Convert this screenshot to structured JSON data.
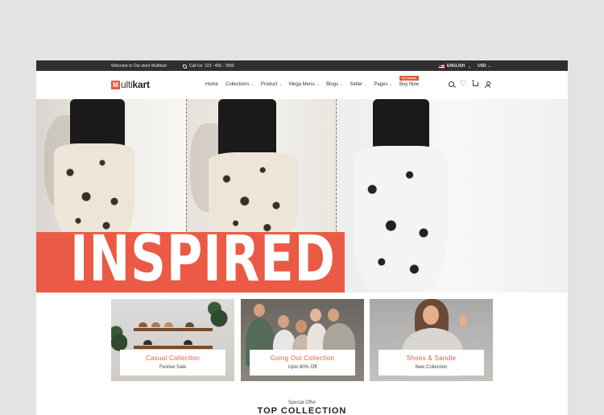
{
  "topbar": {
    "welcome": "Welcome to Our store Multikart",
    "call": "Call Us: 123 - 456 - 7890",
    "language": "ENGLISH",
    "currency": "USD"
  },
  "logo": {
    "mark": "M",
    "text_light": "ulti",
    "text_bold": "kart"
  },
  "nav": {
    "items": [
      {
        "label": "Home",
        "caret": false
      },
      {
        "label": "Collections",
        "caret": true
      },
      {
        "label": "Product",
        "caret": true
      },
      {
        "label": "Mega Menu",
        "caret": true
      },
      {
        "label": "Blogs",
        "caret": true
      },
      {
        "label": "Seller",
        "caret": true
      },
      {
        "label": "Pages",
        "caret": true
      },
      {
        "label": "Buy Now",
        "caret": false,
        "badge": "ALL DEMOS"
      }
    ]
  },
  "header_icons": [
    "search-icon",
    "heart-icon",
    "cart-icon",
    "user-icon"
  ],
  "hero": {
    "headline": "INSPIRED",
    "accent_color": "#ea5a45"
  },
  "collections": [
    {
      "title": "Casual Collection",
      "subtitle": "Festive Sale"
    },
    {
      "title": "Going Out Collection",
      "subtitle": "Upto 80% Off"
    },
    {
      "title": "Shoes & Sandle",
      "subtitle": "New Collection"
    }
  ],
  "section": {
    "kicker": "Special Offer",
    "title": "TOP COLLECTION"
  },
  "colors": {
    "brand": "#e55a3f",
    "topbar": "#2f2f2f"
  }
}
